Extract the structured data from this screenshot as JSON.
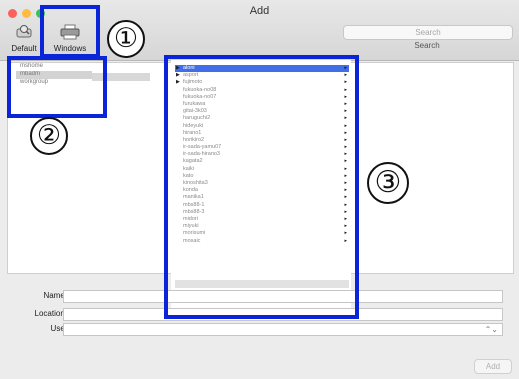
{
  "window": {
    "title": "Add"
  },
  "toolbar": {
    "default_label": "Default",
    "windows_label": "Windows",
    "search_placeholder": "Search",
    "search_label": "Search"
  },
  "callouts": [
    "①",
    "②",
    "③"
  ],
  "form": {
    "name_label": "Name:",
    "location_label": "Location:",
    "use_label": "Use:",
    "add_label": "Add"
  }
}
